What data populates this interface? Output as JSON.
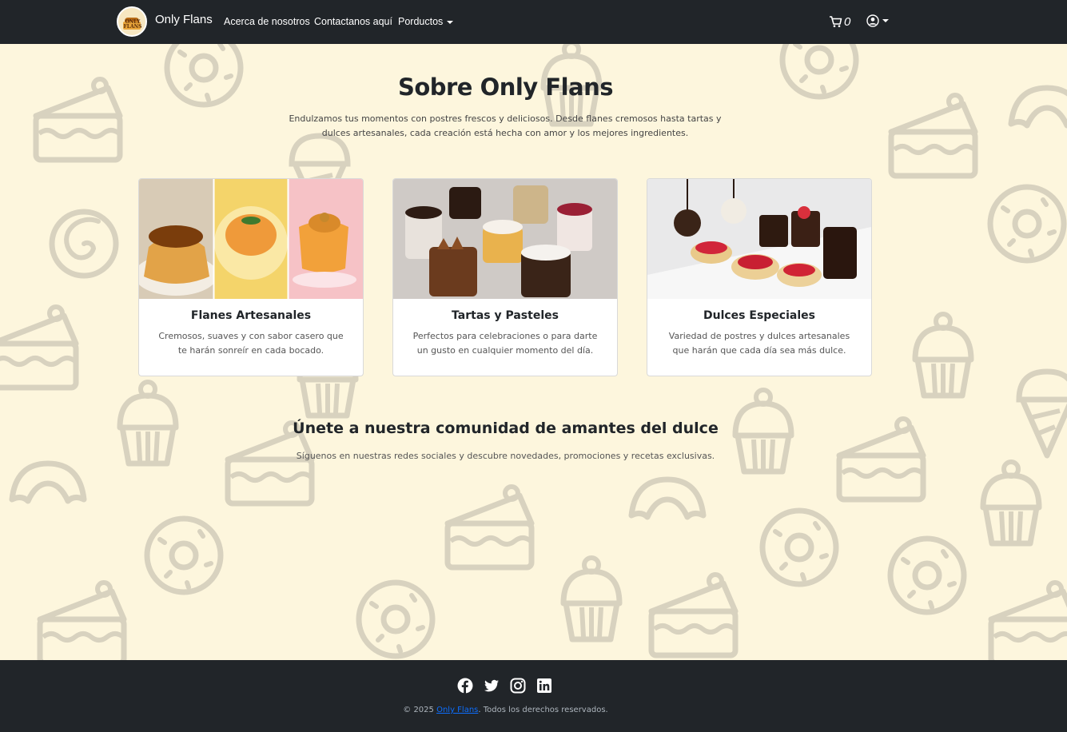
{
  "navbar": {
    "brand_name": "Only Flans",
    "logo_text": "ONLY FLANS",
    "links": [
      "Acerca de nosotros",
      "Contactanos aquí",
      "Porductos"
    ],
    "cart_count": "0",
    "icons": [
      "cart-icon",
      "user-circle-icon",
      "caret-down-icon"
    ]
  },
  "hero": {
    "title": "Sobre Only Flans",
    "description": "Endulzamos tus momentos con postres frescos y deliciosos. Desde flanes cremosos hasta tartas y dulces artesanales, cada creación está hecha con amor y los mejores ingredientes."
  },
  "cards": [
    {
      "title": "Flanes Artesanales",
      "text": "Cremosos, suaves y con sabor casero que te harán sonreír en cada bocado."
    },
    {
      "title": "Tartas y Pasteles",
      "text": "Perfectos para celebraciones o para darte un gusto en cualquier momento del día."
    },
    {
      "title": "Dulces Especiales",
      "text": "Variedad de postres y dulces artesanales que harán que cada día sea más dulce."
    }
  ],
  "community": {
    "title": "Únete a nuestra comunidad de amantes del dulce",
    "text": "Síguenos en nuestras redes sociales y descubre novedades, promociones y recetas exclusivas."
  },
  "footer": {
    "social": [
      "facebook-icon",
      "twitter-icon",
      "instagram-icon",
      "linkedin-icon"
    ],
    "copyright_prefix": "© 2025 ",
    "copyright_link": "Only Flans",
    "copyright_suffix": ". Todos los derechos reservados."
  },
  "colors": {
    "navbar_bg": "#212529",
    "page_bg": "#fdf6dd",
    "pattern": "#d8d2bf",
    "link": "#0d6efd"
  }
}
